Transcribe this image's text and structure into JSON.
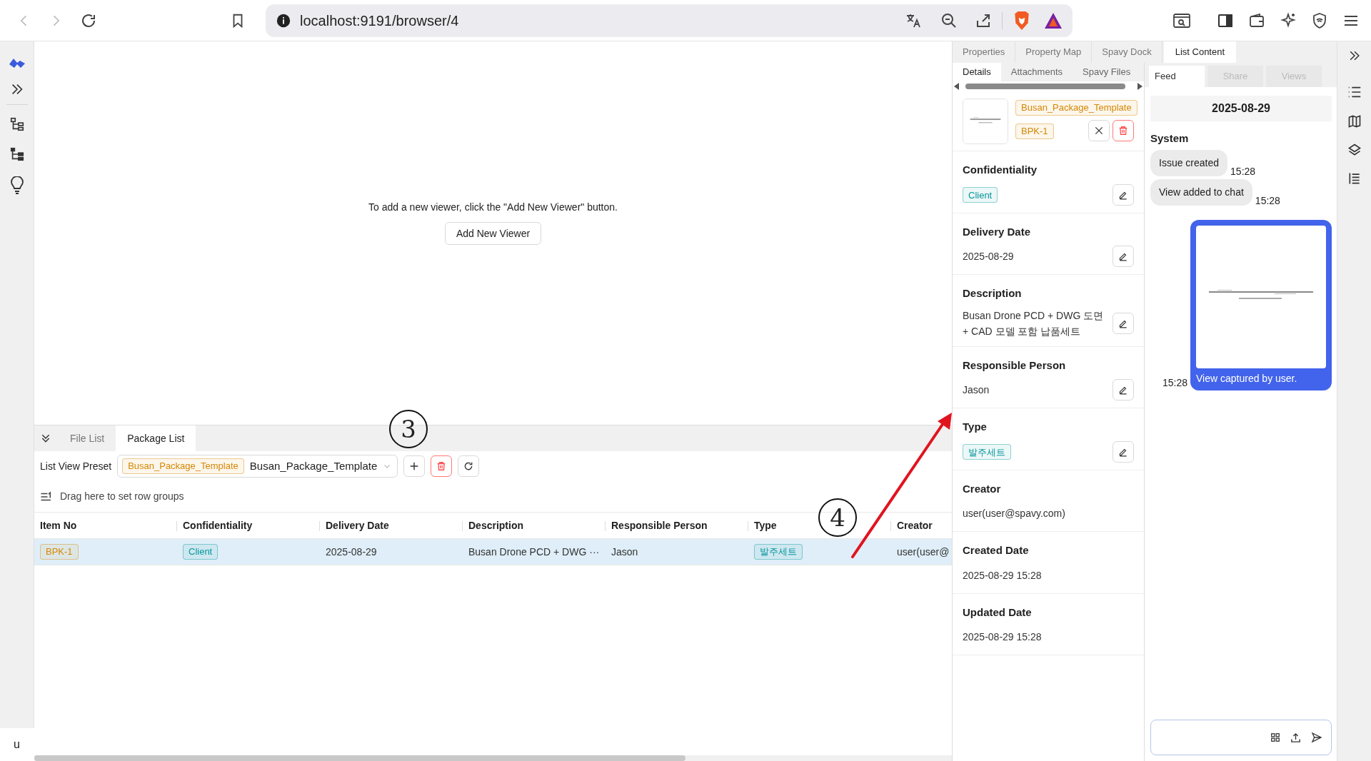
{
  "browser": {
    "url": "localhost:9191/browser/4"
  },
  "left_rail": {
    "user_initial": "u"
  },
  "viewer": {
    "message": "To add a new viewer, click the \"Add New Viewer\" button.",
    "button": "Add New Viewer"
  },
  "bottom_panel": {
    "tabs": [
      {
        "label": "File List",
        "selected": false
      },
      {
        "label": "Package List",
        "selected": true
      }
    ],
    "preset": {
      "label": "List View Preset",
      "tag": {
        "text": "Busan_Package_Template",
        "color": "#d48806"
      },
      "value": "Busan_Package_Template"
    },
    "group_hint": "Drag here to set row groups",
    "table": {
      "columns": [
        "Item No",
        "Confidentiality",
        "Delivery Date",
        "Description",
        "Responsible Person",
        "Type",
        "Creator"
      ],
      "rows": [
        {
          "selected": true,
          "cells": [
            {
              "kind": "tag",
              "text": "BPK-1",
              "color": "#d48806"
            },
            {
              "kind": "tag",
              "text": "Client",
              "color": "#08979c"
            },
            {
              "kind": "text",
              "text": "2025-08-29"
            },
            {
              "kind": "text",
              "text": "Busan Drone PCD + DWG ···"
            },
            {
              "kind": "text",
              "text": "Jason"
            },
            {
              "kind": "tag",
              "text": "발주세트",
              "color": "#08979c"
            },
            {
              "kind": "text",
              "text": "user(user@"
            }
          ]
        }
      ]
    }
  },
  "right_panel": {
    "tabs": [
      {
        "label": "Properties",
        "selected": false
      },
      {
        "label": "Property Map",
        "selected": false
      },
      {
        "label": "Spavy Dock",
        "selected": false
      },
      {
        "label": "List Content",
        "selected": true
      }
    ]
  },
  "properties": {
    "tabs": [
      {
        "label": "Details",
        "selected": true
      },
      {
        "label": "Attachments",
        "selected": false
      },
      {
        "label": "Spavy Files",
        "selected": false
      }
    ],
    "header": {
      "tags": [
        {
          "text": "Busan_Package_Template",
          "color": "#d48806"
        },
        {
          "text": "BPK-1",
          "color": "#d48806"
        }
      ]
    },
    "fields": [
      {
        "label": "Confidentiality",
        "kind": "tag",
        "value": "Client",
        "color": "#08979c",
        "editable": true
      },
      {
        "label": "Delivery Date",
        "kind": "text",
        "value": "2025-08-29",
        "editable": true
      },
      {
        "label": "Description",
        "kind": "text",
        "value": "Busan Drone PCD + DWG 도면 + CAD 모델 포함 납품세트",
        "editable": true
      },
      {
        "label": "Responsible Person",
        "kind": "text",
        "value": "Jason",
        "editable": true
      },
      {
        "label": "Type",
        "kind": "tag",
        "value": "발주세트",
        "color": "#08979c",
        "editable": true
      },
      {
        "label": "Creator",
        "kind": "text",
        "value": "user(user@spavy.com)",
        "editable": false
      },
      {
        "label": "Created Date",
        "kind": "text",
        "value": "2025-08-29 15:28",
        "editable": false
      },
      {
        "label": "Updated Date",
        "kind": "text",
        "value": "2025-08-29 15:28",
        "editable": false
      }
    ]
  },
  "feed": {
    "tabs": [
      {
        "label": "Feed",
        "selected": true
      },
      {
        "label": "Share",
        "selected": false
      },
      {
        "label": "Views",
        "selected": false
      }
    ],
    "date": "2025-08-29",
    "sender": "System",
    "messages": [
      {
        "kind": "bubble",
        "text": "Issue created",
        "time": "15:28"
      },
      {
        "kind": "bubble",
        "text": "View added to chat",
        "time": "15:28"
      },
      {
        "kind": "capture",
        "text": "View captured by user.",
        "time": "15:28"
      }
    ]
  },
  "annotations": [
    {
      "text": "3"
    },
    {
      "text": "4"
    }
  ]
}
